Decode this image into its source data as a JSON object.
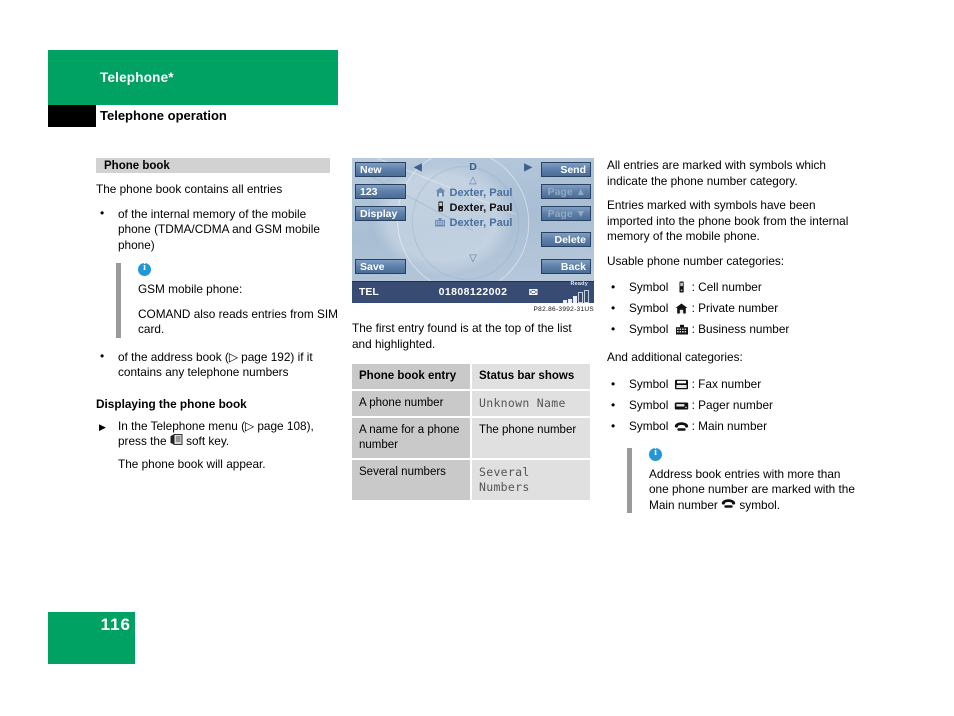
{
  "header": {
    "chapter": "Telephone*",
    "section": "Telephone operation",
    "green": "#00a264"
  },
  "left": {
    "section_bar": "Phone book",
    "intro": "The phone book contains all entries",
    "bullets": [
      "of the internal memory of the mobile phone (TDMA/CDMA and GSM mobile phone)"
    ],
    "info": {
      "icon": "info-circle-icon",
      "line1": "GSM mobile phone:",
      "line2": "COMAND also reads entries from SIM card."
    },
    "bullet2": "of the address book (▷ page 192) if it contains any telephone numbers",
    "subhead": "Displaying the phone book",
    "step_pre": "In the Telephone menu (▷ page 108), press the ",
    "step_post": " soft key.",
    "step_icon": "phonebook-softkey-icon",
    "result": "The phone book will appear."
  },
  "screen": {
    "softkeys_left": [
      {
        "label": "New",
        "disabled": false
      },
      {
        "label": "123",
        "disabled": false
      },
      {
        "label": "Display",
        "disabled": false
      },
      {
        "label": "Save",
        "disabled": false
      }
    ],
    "softkeys_right": [
      {
        "label": "Send",
        "disabled": false
      },
      {
        "label": "Page ▲",
        "disabled": true
      },
      {
        "label": "Page ▼",
        "disabled": true
      },
      {
        "label": "Delete",
        "disabled": false
      },
      {
        "label": "Back",
        "disabled": false
      }
    ],
    "nav_letter": "D",
    "nav_left_icon": "triangle-left-icon",
    "nav_right_icon": "triangle-right-icon",
    "scroll_up_icon": "triangle-up-outline-icon",
    "scroll_down_icon": "triangle-down-outline-icon",
    "entries": [
      {
        "symbol": "private-home-icon",
        "name": "Dexter, Paul",
        "selected": false
      },
      {
        "symbol": "cell-phone-icon",
        "name": "Dexter, Paul",
        "selected": true
      },
      {
        "symbol": "business-icon",
        "name": "Dexter, Paul",
        "selected": false
      }
    ],
    "status": {
      "mode": "TEL",
      "number": "01808122002",
      "envelope_icon": "envelope-icon",
      "ready_label": "Ready",
      "signal_icon": "signal-bars-icon"
    },
    "figure_caption": "P82.86-3992-31US"
  },
  "middle": {
    "caption_text": "The first entry found is at the top of the list and highlighted.",
    "table": {
      "headers": [
        "Phone book entry",
        "Status bar shows"
      ],
      "rows": [
        [
          "A phone number",
          "Unknown Name"
        ],
        [
          "A name for a phone number",
          "The phone number"
        ],
        [
          "Several numbers",
          "Several Numbers"
        ]
      ],
      "mono_cells": [
        true,
        false,
        true
      ]
    }
  },
  "right": {
    "para1": "All entries are marked with symbols which indicate the phone number category.",
    "para2": "Entries marked with symbols have been imported into the phone book from the internal memory of the mobile phone.",
    "para3": "Usable phone number categories:",
    "categories": [
      {
        "prefix": "Symbol",
        "icon": "cell-phone-icon",
        "label": ": Cell number"
      },
      {
        "prefix": "Symbol",
        "icon": "private-home-icon",
        "label": ": Private number"
      },
      {
        "prefix": "Symbol",
        "icon": "business-icon",
        "label": ": Business number"
      }
    ],
    "para4": "And additional categories:",
    "additional": [
      {
        "prefix": "Symbol",
        "icon": "fax-icon",
        "label": ": Fax number"
      },
      {
        "prefix": "Symbol",
        "icon": "pager-icon",
        "label": ": Pager number"
      },
      {
        "prefix": "Symbol",
        "icon": "main-phone-icon",
        "label": ": Main number"
      }
    ],
    "info": {
      "icon": "info-circle-icon",
      "text_pre": "Address book entries with more than one phone number are marked with the Main number ",
      "text_post": " symbol.",
      "inline_icon": "main-phone-icon"
    }
  },
  "footer": {
    "page_number": "116"
  }
}
